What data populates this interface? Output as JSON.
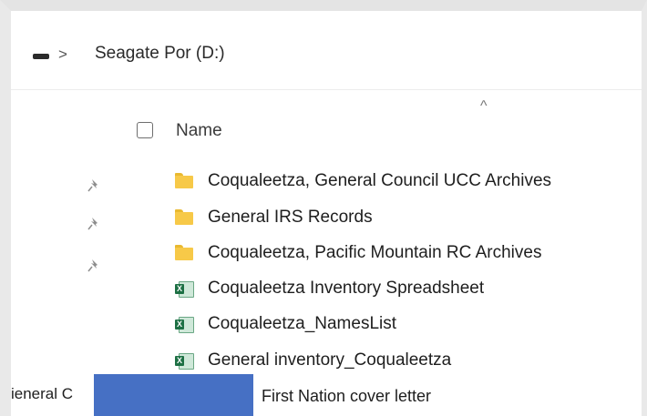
{
  "breadcrumb": {
    "separator": ">",
    "drive": "Seagate Por (D:)"
  },
  "column_header": {
    "name": "Name",
    "sort_indicator": "^"
  },
  "files": [
    {
      "name": "Coqualeetza, General Council UCC Archives",
      "type": "folder",
      "pinned": true
    },
    {
      "name": "General IRS Records",
      "type": "folder",
      "pinned": true
    },
    {
      "name": "Coqualeetza, Pacific Mountain RC Archives",
      "type": "folder",
      "pinned": true
    },
    {
      "name": "Coqualeetza Inventory Spreadsheet",
      "type": "excel",
      "pinned": false
    },
    {
      "name": "Coqualeetza_NamesList",
      "type": "excel",
      "pinned": false
    },
    {
      "name": "General inventory_Coqualeetza",
      "type": "excel",
      "pinned": false
    }
  ],
  "partial_row": {
    "left_text": "ieneral C",
    "right_text": "First Nation cover letter"
  },
  "colors": {
    "folder": "#f7c948",
    "excel": "#1d7044",
    "overlay": "#4670c4"
  },
  "icons": {
    "drive": "drive-icon",
    "folder": "folder-icon",
    "excel": "excel-icon",
    "pin": "pin-icon"
  }
}
